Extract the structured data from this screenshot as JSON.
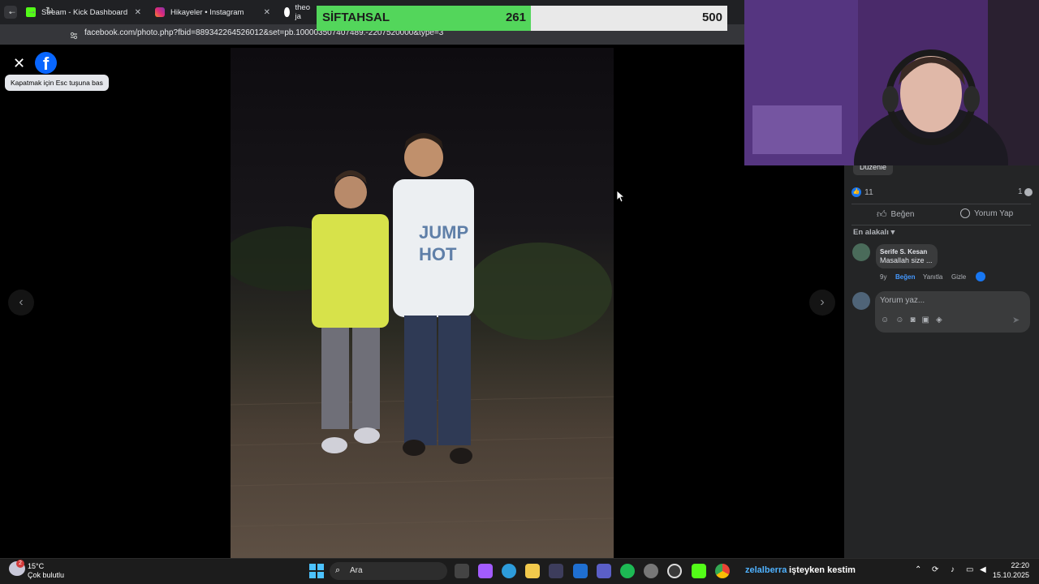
{
  "browser": {
    "tabs": [
      {
        "title": "Stream - Kick Dashboard",
        "icon": "kick-icon",
        "color": "#53fc18"
      },
      {
        "title": "Hikayeler • Instagram",
        "icon": "instagram-icon",
        "color": "#dd2a7b"
      },
      {
        "title": "theo ja",
        "icon": "google-icon",
        "color": "#ffffff"
      }
    ],
    "url": "facebook.com/photo.php?fbid=889342264526012&set=pb.100003507407489.-2207520000&type=3"
  },
  "goal_bar": {
    "name": "SİFTAHSAL",
    "current": "261",
    "target": "500",
    "progress": 0.522,
    "fill_color": "#53d65b"
  },
  "viewer": {
    "esc_tooltip": "Kapatmak için Esc tuşuna bas",
    "logo": "f"
  },
  "panel": {
    "edit_label": "Düzenle",
    "reaction_count": "11",
    "comment_count": "1",
    "like_label": "Beğen",
    "comment_label": "Yorum Yap",
    "sort_label": "En alakalı",
    "comment": {
      "author": "Serife S. Kesan",
      "text": "Masallah size ...",
      "age": "9y",
      "like": "Beğen",
      "reply": "Yanıtla",
      "hide": "Gizle"
    },
    "input_placeholder": "Yorum yaz..."
  },
  "taskbar": {
    "weather_temp": "15°C",
    "weather_desc": "Çok bulutlu",
    "weather_badge": "2",
    "search_label": "Ara",
    "now_playing_user": "zelalberra",
    "now_playing_text": "işteyken kestim",
    "time": "22:20",
    "date": "15.10.2025"
  }
}
